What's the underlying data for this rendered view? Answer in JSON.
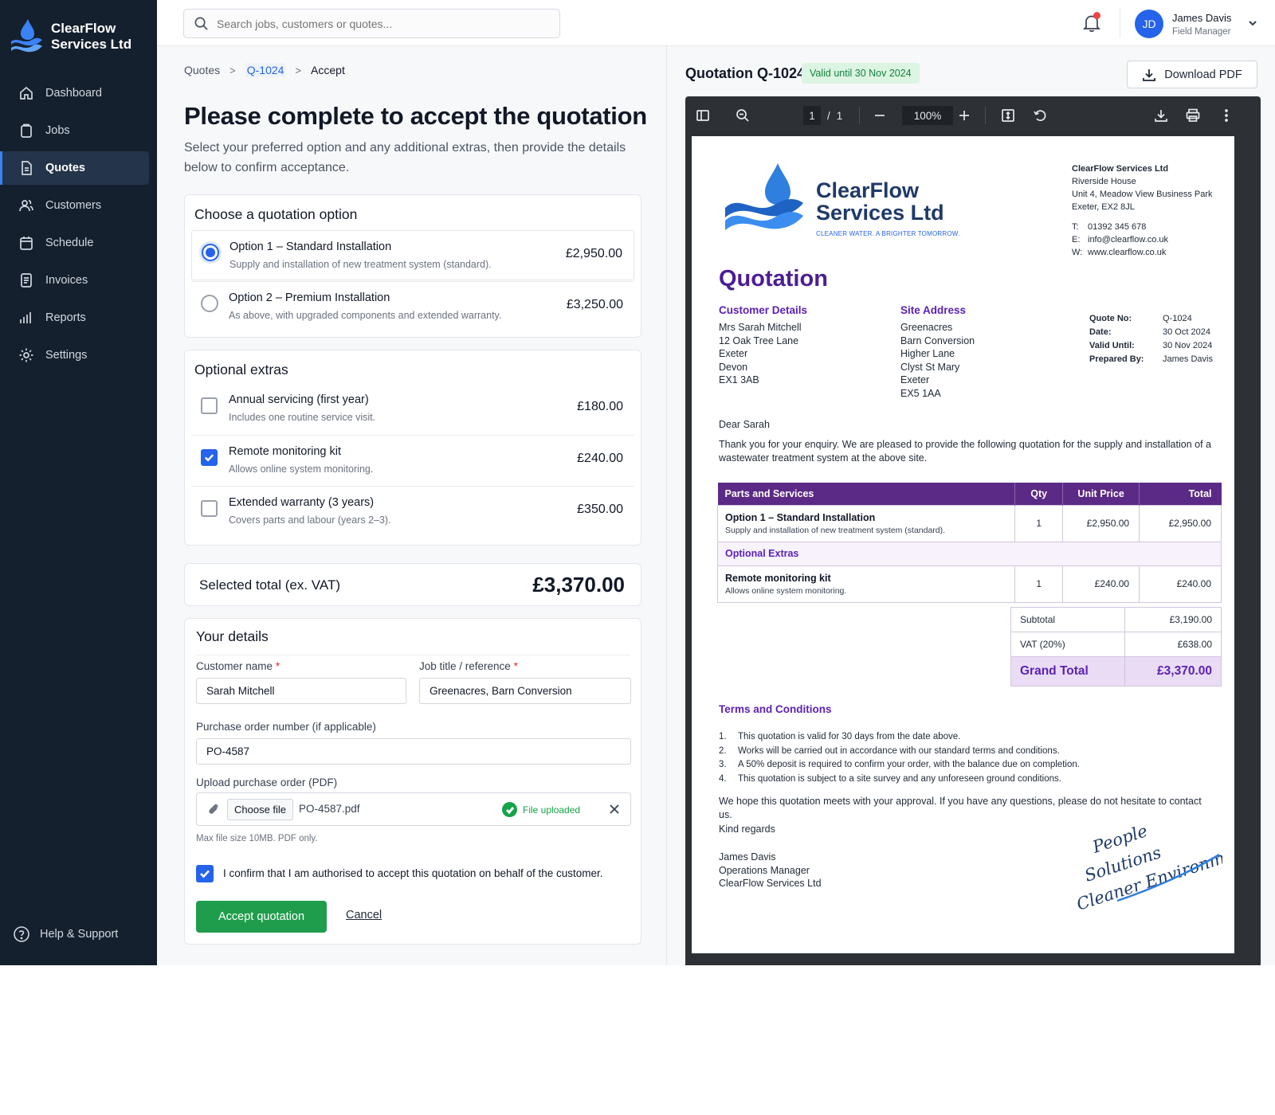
{
  "brand": {
    "name": "ClearFlow Services Ltd"
  },
  "sidebar": {
    "items": [
      {
        "label": "Dashboard",
        "icon": "home-icon"
      },
      {
        "label": "Jobs",
        "icon": "clipboard-icon"
      },
      {
        "label": "Quotes",
        "icon": "document-icon",
        "active": true
      },
      {
        "label": "Customers",
        "icon": "users-icon"
      },
      {
        "label": "Schedule",
        "icon": "calendar-icon"
      },
      {
        "label": "Invoices",
        "icon": "invoice-icon"
      },
      {
        "label": "Reports",
        "icon": "bar-chart-icon"
      },
      {
        "label": "Settings",
        "icon": "gear-icon"
      }
    ],
    "help": "Help & Support"
  },
  "topbar": {
    "search_placeholder": "Search jobs, customers or quotes...",
    "user": {
      "initials": "JD",
      "name": "James Davis",
      "role": "Field Manager"
    }
  },
  "breadcrumb": {
    "root": "Quotes",
    "quote": "Q-1024",
    "current": "Accept"
  },
  "form": {
    "title": "Please complete to accept the quotation",
    "subtitle": "Select your preferred option and any additional extras, then provide the details below to confirm acceptance.",
    "options_title": "Choose a quotation option",
    "options": [
      {
        "name": "Option 1 – Standard Installation",
        "desc": "Supply and installation of new treatment system (standard).",
        "price": "£2,950.00",
        "selected": true
      },
      {
        "name": "Option 2 – Premium Installation",
        "desc": "As above, with upgraded components and extended warranty.",
        "price": "£3,250.00",
        "selected": false
      }
    ],
    "extras_title": "Optional extras",
    "extras": [
      {
        "name": "Annual servicing (first year)",
        "desc": "Includes one routine service visit.",
        "price": "£180.00",
        "checked": false
      },
      {
        "name": "Remote monitoring kit",
        "desc": "Allows online system monitoring.",
        "price": "£240.00",
        "checked": true
      },
      {
        "name": "Extended warranty (3 years)",
        "desc": "Covers parts and labour (years 2–3).",
        "price": "£350.00",
        "checked": false
      }
    ],
    "total_label": "Selected total (ex. VAT)",
    "total_value": "£3,370.00",
    "details_title": "Your details",
    "customer_name_label": "Customer name",
    "customer_name_value": "Sarah Mitchell",
    "job_label": "Job title / reference",
    "job_value": "Greenacres, Barn Conversion",
    "po_label": "Purchase order number (if applicable)",
    "po_value": "PO-4587",
    "upload_label": "Upload purchase order (PDF)",
    "choose_file": "Choose file",
    "file_name": "PO-4587.pdf",
    "upload_status": "File uploaded",
    "upload_hint": "Max file size 10MB. PDF only.",
    "required_mark": "*",
    "confirm_text": "I confirm that I am authorised to accept this quotation on behalf of the customer.",
    "accept_label": "Accept quotation",
    "cancel_label": "Cancel"
  },
  "preview": {
    "title": "Quotation Q-1024",
    "valid_badge": "Valid until 30 Nov 2024",
    "download_label": "Download PDF",
    "toolbar": {
      "page_current": "1",
      "page_sep": "/",
      "page_total": "1",
      "zoom": "100%"
    }
  },
  "document": {
    "company_line1": "ClearFlow",
    "company_line2": "Services Ltd",
    "tagline": "CLEANER WATER. A BRIGHTER TOMORROW.",
    "address": [
      "ClearFlow Services Ltd",
      "Riverside House",
      "Unit 4, Meadow View Business Park",
      "Exeter, EX2 8JL"
    ],
    "contact": [
      {
        "k": "T:",
        "v": "01392 345 678"
      },
      {
        "k": "E:",
        "v": "info@clearflow.co.uk"
      },
      {
        "k": "W:",
        "v": "www.clearflow.co.uk"
      }
    ],
    "heading": "Quotation",
    "customer_title": "Customer Details",
    "customer_lines": [
      "Mrs Sarah Mitchell",
      "12 Oak Tree Lane",
      "Exeter",
      "Devon",
      "EX1 3AB"
    ],
    "site_title": "Site Address",
    "site_lines": [
      "Greenacres",
      "Barn Conversion",
      "Higher Lane",
      "Clyst St Mary",
      "Exeter",
      "EX5 1AA"
    ],
    "meta": [
      {
        "k": "Quote No:",
        "v": "Q-1024"
      },
      {
        "k": "Date:",
        "v": "30 Oct 2024"
      },
      {
        "k": "Valid Until:",
        "v": "30 Nov 2024"
      },
      {
        "k": "Prepared By:",
        "v": "James Davis"
      }
    ],
    "greeting": "Dear Sarah",
    "intro": "Thank you for your enquiry. We are pleased to provide the following quotation for the supply and installation of a wastewater treatment system at the above site.",
    "table_headers": [
      "Parts and Services",
      "Qty",
      "Unit Price",
      "Total"
    ],
    "row1": {
      "name": "Option 1 – Standard Installation",
      "desc": "Supply and installation of new treatment system (standard).",
      "qty": "1",
      "unit": "£2,950.00",
      "total": "£2,950.00"
    },
    "extras_heading": "Optional Extras",
    "row2": {
      "name": "Remote monitoring kit",
      "desc": "Allows online system monitoring.",
      "qty": "1",
      "unit": "£240.00",
      "total": "£240.00"
    },
    "subtotal_label": "Subtotal",
    "subtotal_value": "£3,190.00",
    "vat_label": "VAT (20%)",
    "vat_value": "£638.00",
    "grand_label": "Grand Total",
    "grand_value": "£3,370.00",
    "terms_title": "Terms and Conditions",
    "terms": [
      {
        "n": "1.",
        "t": "This quotation is valid for 30 days from the date above."
      },
      {
        "n": "2.",
        "t": "Works will be carried out in accordance with our standard terms and conditions."
      },
      {
        "n": "3.",
        "t": "A 50% deposit is required to confirm your order, with the balance due on completion."
      },
      {
        "n": "4.",
        "t": "This quotation is subject to a site survey and any unforeseen ground conditions."
      }
    ],
    "closing": "We hope this quotation meets with your approval. If you have any questions, please do not hesitate to contact us.",
    "regards": "Kind regards",
    "signoff": [
      "James Davis",
      "Operations Manager",
      "ClearFlow Services Ltd"
    ],
    "signature_lines": [
      "People",
      "Solutions",
      "Cleaner Environments"
    ]
  },
  "colors": {
    "sidebar_bg": "#15202e",
    "accent": "#2563eb",
    "success": "#1f9d4c",
    "doc_purple": "#5b2a86"
  }
}
